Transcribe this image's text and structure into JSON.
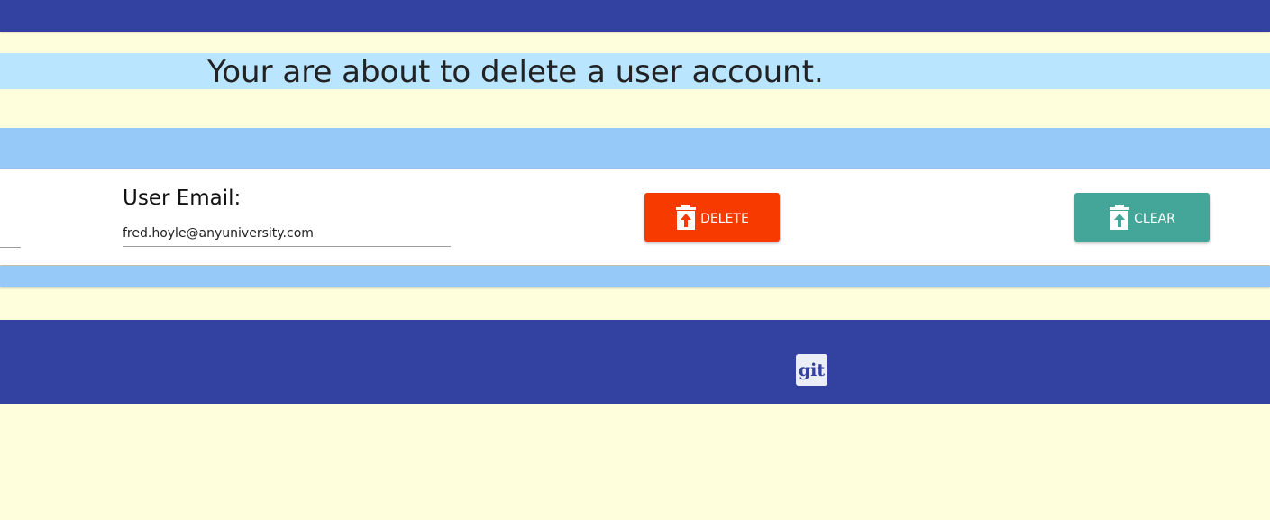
{
  "heading": {
    "text": "Your are about to delete a user account."
  },
  "form": {
    "email_label": "User Email:",
    "email_value": "fred.hoyle@anyuniversity.com"
  },
  "buttons": {
    "delete": {
      "label": "DELETE",
      "icon": "trash-upload-icon",
      "color": "#f73b00"
    },
    "clear": {
      "label": "CLEAR",
      "icon": "trash-upload-icon",
      "color": "#44a699"
    }
  },
  "footer": {
    "git_label": "git"
  },
  "colors": {
    "header": "#3341a0",
    "background": "#fffedc",
    "title_band": "#b9e6fe",
    "blue_band": "#96c9f8"
  }
}
